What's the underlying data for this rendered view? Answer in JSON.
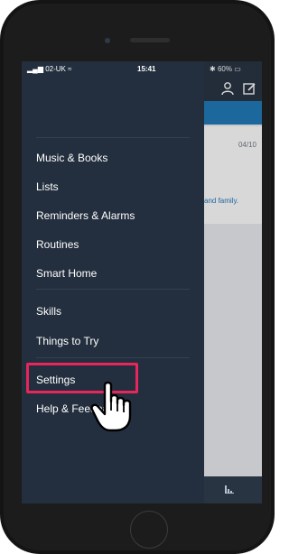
{
  "status_bar": {
    "carrier": "02-UK",
    "time": "15:41",
    "battery": "60%"
  },
  "drawer": {
    "items": [
      {
        "label": "Music & Books"
      },
      {
        "label": "Lists"
      },
      {
        "label": "Reminders & Alarms"
      },
      {
        "label": "Routines"
      },
      {
        "label": "Smart Home"
      },
      {
        "label": "Skills"
      },
      {
        "label": "Things to Try"
      },
      {
        "label": "Settings"
      },
      {
        "label": "Help & Feedback"
      }
    ]
  },
  "background_card": {
    "date": "04/10",
    "link_text": "and family."
  },
  "icons": {
    "profile": "person-icon",
    "compose": "compose-icon",
    "home": "home-icon",
    "cursor": "hand-pointer-icon"
  },
  "colors": {
    "drawer": "#232f3e",
    "accent_blue": "#1a77b6",
    "highlight": "#e7265b"
  }
}
